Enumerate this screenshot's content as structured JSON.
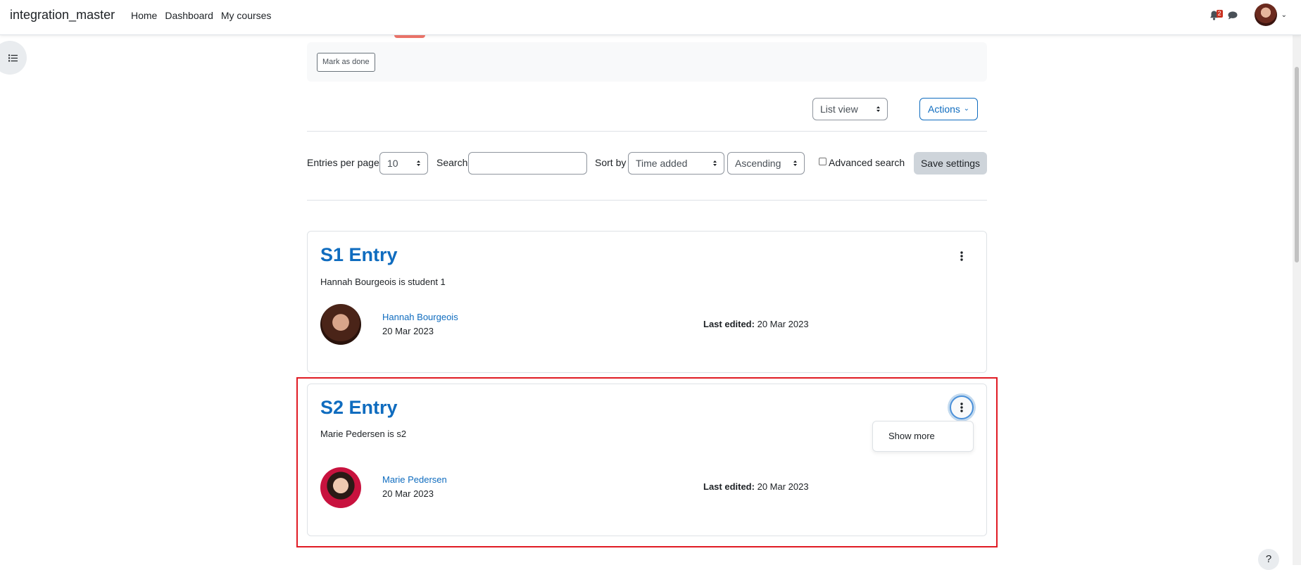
{
  "navbar": {
    "site_name": "integration_master",
    "links": [
      "Home",
      "Dashboard",
      "My courses"
    ],
    "notification_count": "2",
    "icons": {
      "notifications": "bell-icon",
      "messages": "chat-icon",
      "user_menu": "chevron-down-icon"
    }
  },
  "activity": {
    "mark_done_label": "Mark as done"
  },
  "toolbar": {
    "view_select": "List view",
    "actions_label": "Actions"
  },
  "filters": {
    "entries_per_page_label": "Entries per page",
    "entries_per_page_value": "10",
    "search_label": "Search",
    "search_value": "",
    "sort_by_label": "Sort by",
    "sort_by_value": "Time added",
    "order_value": "Ascending",
    "advanced_search_label": "Advanced search",
    "advanced_search_checked": false,
    "save_label": "Save settings"
  },
  "entries": [
    {
      "title": "S1 Entry",
      "description": "Hannah Bourgeois is student 1",
      "author": "Hannah Bourgeois",
      "date": "20 Mar 2023",
      "last_edited_label": "Last edited:",
      "last_edited_value": "20 Mar 2023"
    },
    {
      "title": "S2 Entry",
      "description": "Marie Pedersen is s2",
      "author": "Marie Pedersen",
      "date": "20 Mar 2023",
      "last_edited_label": "Last edited:",
      "last_edited_value": "20 Mar 2023",
      "menu_item": "Show more"
    }
  ],
  "help_label": "?",
  "colors": {
    "link": "#0f6cbf",
    "badge": "#ca3120",
    "highlight": "#e01b24"
  }
}
